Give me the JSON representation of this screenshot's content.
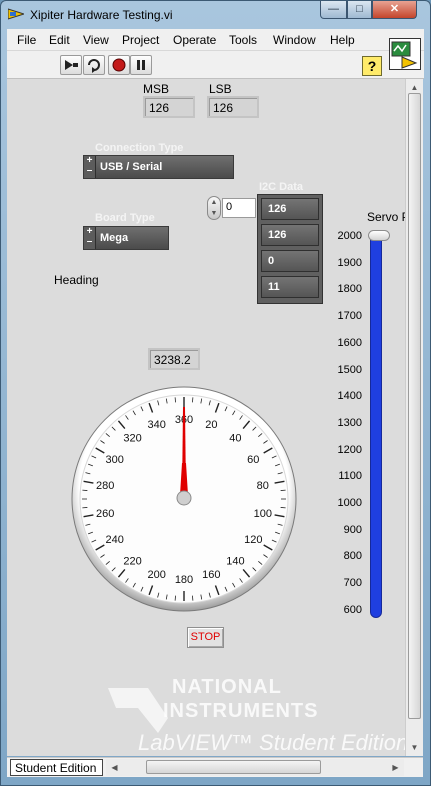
{
  "window": {
    "title": "Xipiter Hardware Testing.vi",
    "minimize_glyph": "—",
    "maximize_glyph": "□",
    "close_glyph": "✕"
  },
  "menu": {
    "items": [
      "File",
      "Edit",
      "View",
      "Project",
      "Operate",
      "Tools",
      "Window",
      "Help"
    ]
  },
  "toolbar": {
    "icons": [
      "run-arrow-icon",
      "run-continuously-icon",
      "abort-icon",
      "pause-icon"
    ],
    "help_label": "?"
  },
  "msb": {
    "label": "MSB",
    "value": "126"
  },
  "lsb": {
    "label": "LSB",
    "value": "126"
  },
  "connection_type": {
    "label": "Connection Type",
    "value": "USB / Serial"
  },
  "board_type": {
    "label": "Board Type",
    "value": "Mega"
  },
  "i2c": {
    "label": "I2C Data",
    "index": "0",
    "values": [
      "126",
      "126",
      "0",
      "11"
    ]
  },
  "heading": {
    "label": "Heading",
    "value": "3238.2",
    "needle_deg": 0
  },
  "gauge_scale": [
    "360",
    "20",
    "40",
    "60",
    "80",
    "100",
    "120",
    "140",
    "160",
    "180",
    "200",
    "220",
    "240",
    "260",
    "280",
    "300",
    "320",
    "340"
  ],
  "servo": {
    "label": "Servo P",
    "scale": [
      "2000",
      "1900",
      "1800",
      "1700",
      "1600",
      "1500",
      "1400",
      "1300",
      "1200",
      "1100",
      "1000",
      "900",
      "800",
      "700",
      "600"
    ],
    "value": 2000,
    "min": 600,
    "max": 2000
  },
  "stop_label": "STOP",
  "watermark": {
    "line1": "NATIONAL",
    "line2": "INSTRUMENTS",
    "line3": "LabVIEW™ Student Edition"
  },
  "statusbar": {
    "edition": "Student Edition"
  },
  "colors": {
    "needle": "#e00000",
    "slider_fill": "#1f3fe0",
    "stop_text": "#e00000"
  }
}
